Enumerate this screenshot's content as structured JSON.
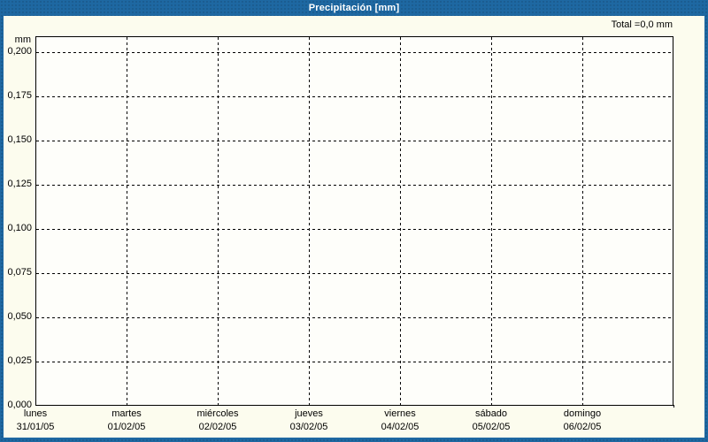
{
  "window": {
    "title": "Precipitación [mm]"
  },
  "summary": {
    "total_label": "Total =0,0 mm"
  },
  "axes": {
    "unit_label": "mm",
    "y_ticks": [
      "0,200",
      "0,175",
      "0,150",
      "0,125",
      "0,100",
      "0,075",
      "0,050",
      "0,025",
      "0,000"
    ],
    "x_ticks": [
      {
        "day": "lunes",
        "date": "31/01/05"
      },
      {
        "day": "martes",
        "date": "01/02/05"
      },
      {
        "day": "miércoles",
        "date": "02/02/05"
      },
      {
        "day": "jueves",
        "date": "03/02/05"
      },
      {
        "day": "viernes",
        "date": "04/02/05"
      },
      {
        "day": "sábado",
        "date": "05/02/05"
      },
      {
        "day": "domingo",
        "date": "06/02/05"
      }
    ]
  },
  "colors": {
    "frame_blue": "#1E68A2",
    "content_bg": "#FCFCEE",
    "plot_bg": "#FEFEFA",
    "grid": "#000000",
    "title_text": "#FFFFFF",
    "label_text": "#000000"
  },
  "chart_data": {
    "type": "bar",
    "title": "Precipitación [mm]",
    "ylabel": "mm",
    "ylim": [
      0,
      0.21
    ],
    "y_tick_values": [
      0.2,
      0.175,
      0.15,
      0.125,
      0.1,
      0.075,
      0.05,
      0.025,
      0.0
    ],
    "categories": [
      "lunes 31/01/05",
      "martes 01/02/05",
      "miércoles 02/02/05",
      "jueves 03/02/05",
      "viernes 04/02/05",
      "sábado 05/02/05",
      "domingo 06/02/05"
    ],
    "values": [
      0,
      0,
      0,
      0,
      0,
      0,
      0
    ],
    "grid": true,
    "grid_style": "dashed",
    "legend": false,
    "annotation": "Total =0,0 mm"
  }
}
